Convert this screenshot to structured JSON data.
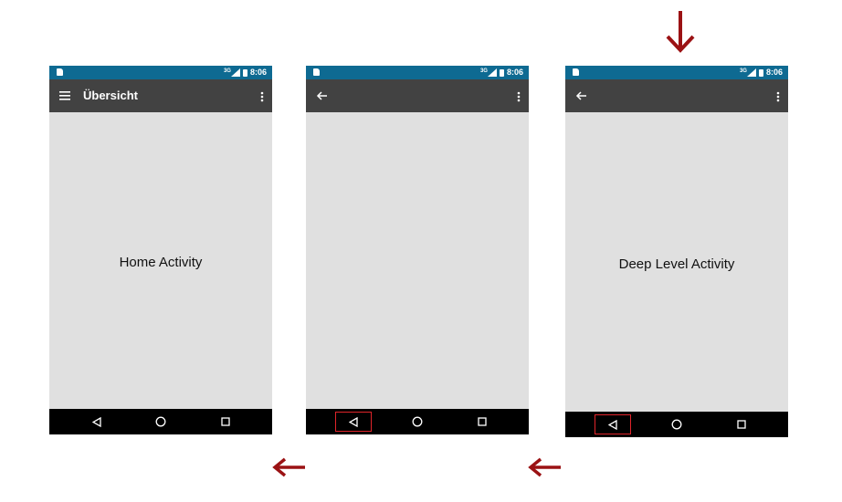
{
  "colors": {
    "status_bar": "#0e6a92",
    "toolbar": "#424242",
    "content_bg": "#e0e0e0",
    "nav_bar": "#000000",
    "flow_arrow": "#9b1214",
    "highlight": "#e0242a"
  },
  "screens": [
    {
      "status": {
        "network": "3G",
        "time": "8:06"
      },
      "toolbar": {
        "nav_icon": "hamburger-menu-icon",
        "title": "Übersicht",
        "overflow_icon": "overflow-menu-icon"
      },
      "content_text": "Home Activity",
      "navbar": {
        "back_highlighted": false
      }
    },
    {
      "status": {
        "network": "3G",
        "time": "8:06"
      },
      "toolbar": {
        "nav_icon": "back-arrow-icon",
        "title": "",
        "overflow_icon": "overflow-menu-icon"
      },
      "content_text": "",
      "navbar": {
        "back_highlighted": true
      }
    },
    {
      "status": {
        "network": "3G",
        "time": "8:06"
      },
      "toolbar": {
        "nav_icon": "back-arrow-icon",
        "title": "",
        "overflow_icon": "overflow-menu-icon"
      },
      "content_text": "Deep Level Activity",
      "navbar": {
        "back_highlighted": true
      }
    }
  ],
  "flow_arrows": [
    {
      "icon": "down-arrow-icon",
      "direction": "down"
    },
    {
      "icon": "left-arrow-icon",
      "direction": "left"
    },
    {
      "icon": "left-arrow-icon",
      "direction": "left"
    }
  ]
}
